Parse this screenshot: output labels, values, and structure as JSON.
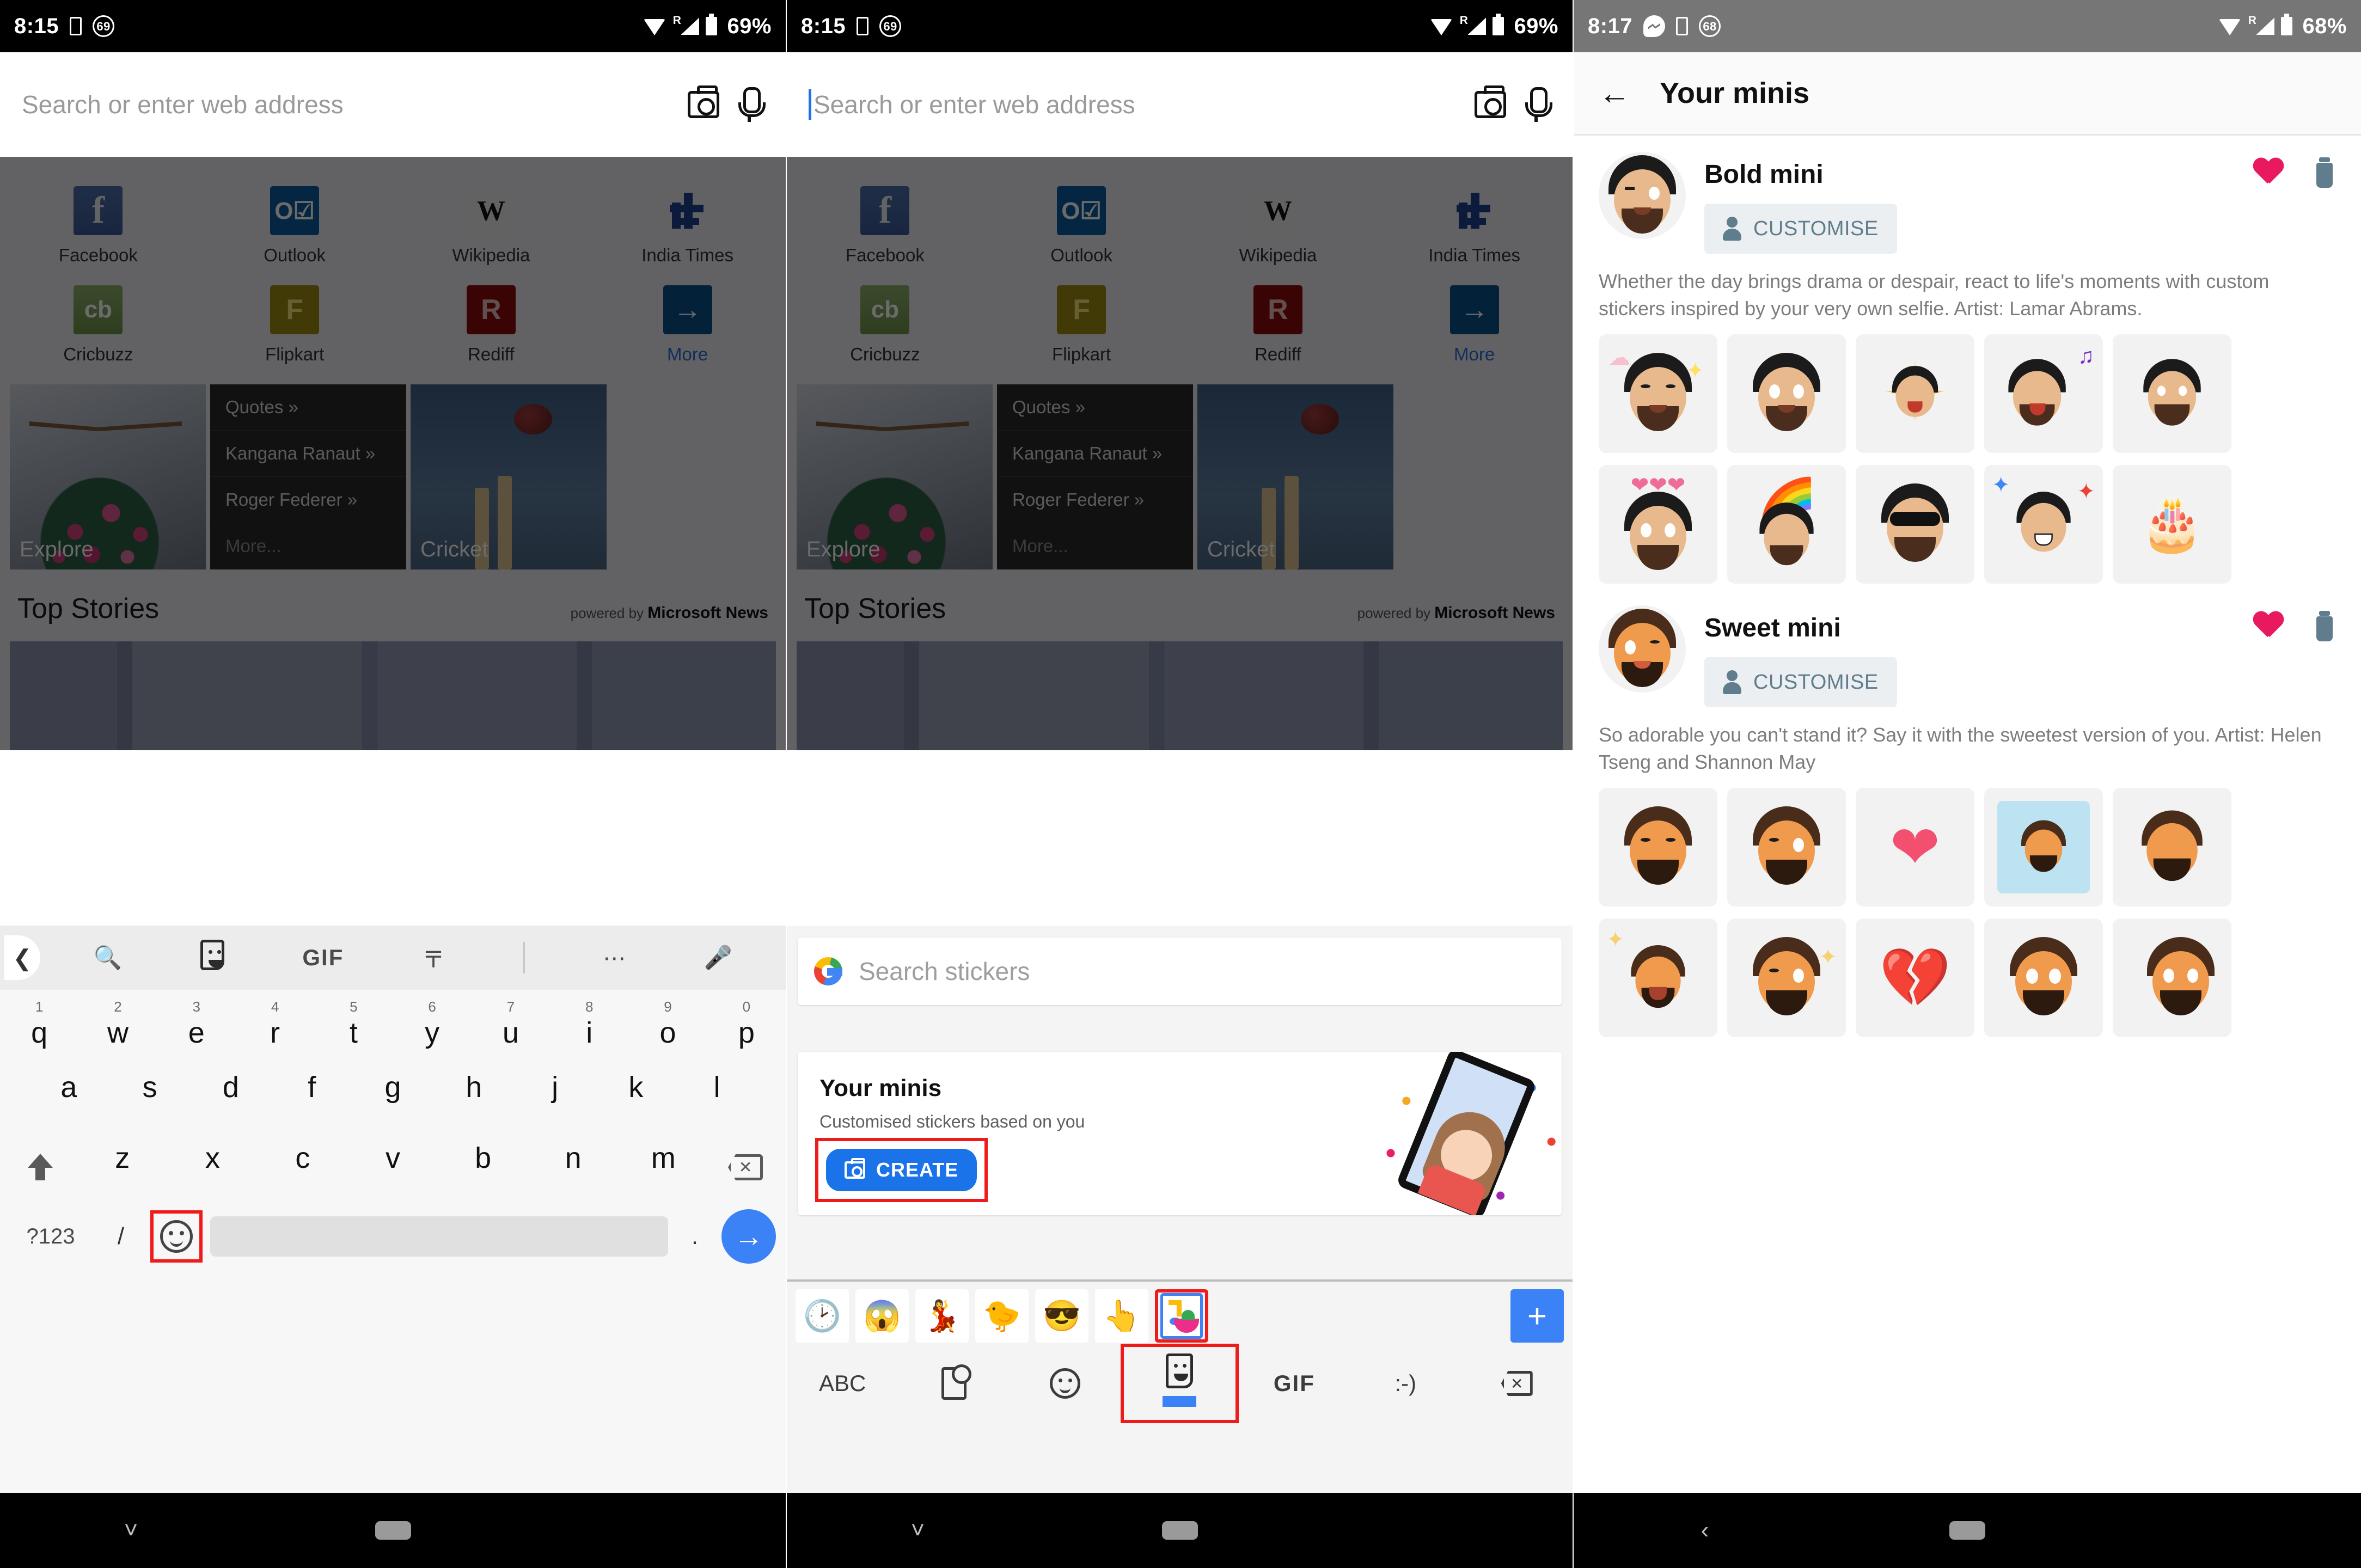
{
  "panel1": {
    "statusbar": {
      "time": "8:15",
      "dnd": "69",
      "battery": "69%",
      "roaming": "R"
    },
    "addressbar": {
      "placeholder": "Search or enter web address",
      "value": "",
      "camera_icon": "camera-icon",
      "mic_icon": "microphone-icon"
    },
    "shortcuts": [
      {
        "label": "Facebook",
        "glyph": "f",
        "type": "fb"
      },
      {
        "label": "Outlook",
        "glyph": "O",
        "type": "ol"
      },
      {
        "label": "Wikipedia",
        "glyph": "W",
        "type": "wk"
      },
      {
        "label": "India Times",
        "glyph": "",
        "type": "it"
      },
      {
        "label": "Cricbuzz",
        "glyph": "cb",
        "type": "cb"
      },
      {
        "label": "Flipkart",
        "glyph": "F",
        "type": "fk"
      },
      {
        "label": "Rediff",
        "glyph": "R",
        "type": "rd"
      },
      {
        "label": "More",
        "glyph": "→",
        "type": "mr"
      }
    ],
    "cards": {
      "explore": "Explore",
      "cricket": "Cricket",
      "quotes": [
        "Quotes »",
        "Kangana Ranaut »",
        "Roger Federer »",
        "More..."
      ]
    },
    "topstories": {
      "title": "Top Stories",
      "powered_prefix": "powered by",
      "powered_brand": "Microsoft News"
    },
    "keyboard": {
      "toolbar": [
        "back-chevron",
        "search-icon",
        "sticker-icon",
        "GIF",
        "translate-icon",
        "more-icon",
        "microphone-icon"
      ],
      "gif_label": "GIF",
      "row1": [
        {
          "num": "1",
          "ltr": "q"
        },
        {
          "num": "2",
          "ltr": "w"
        },
        {
          "num": "3",
          "ltr": "e"
        },
        {
          "num": "4",
          "ltr": "r"
        },
        {
          "num": "5",
          "ltr": "t"
        },
        {
          "num": "6",
          "ltr": "y"
        },
        {
          "num": "7",
          "ltr": "u"
        },
        {
          "num": "8",
          "ltr": "i"
        },
        {
          "num": "9",
          "ltr": "o"
        },
        {
          "num": "0",
          "ltr": "p"
        }
      ],
      "row2": [
        "a",
        "s",
        "d",
        "f",
        "g",
        "h",
        "j",
        "k",
        "l"
      ],
      "row3": [
        "z",
        "x",
        "c",
        "v",
        "b",
        "n",
        "m"
      ],
      "symbols_key": "?123",
      "slash_key": "/",
      "emoji_key": "emoji-smiley-icon",
      "period_key": ".",
      "go_key": "→",
      "highlight_color": "#ef1b1b"
    }
  },
  "panel2": {
    "statusbar": {
      "time": "8:15",
      "dnd": "69",
      "battery": "69%",
      "roaming": "R"
    },
    "addressbar": {
      "placeholder": "Search or enter web address",
      "value": "",
      "caret": true
    },
    "sticker_search": {
      "placeholder": "Search stickers",
      "logo": "google-logo-icon"
    },
    "minis_promo": {
      "title": "Your minis",
      "subtitle": "Customised stickers based on you",
      "create_label": "CREATE",
      "create_icon": "camera-icon",
      "highlighted": true
    },
    "sticker_tabs": [
      "recent-clock-icon",
      "shocked-sticker",
      "dancer-sticker",
      "duck-sticker",
      "sunglasses-sticker",
      "thumbsup-sticker",
      "your-minis-tab"
    ],
    "add_pack_label": "+",
    "keyboard_bottom": [
      "ABC",
      "sticker-search-icon",
      "emoji-icon",
      "sticker-icon",
      "GIF",
      ":-)",
      "backspace-icon"
    ],
    "abc_label": "ABC",
    "gif_label": "GIF",
    "emoticon_label": ":-)"
  },
  "panel3": {
    "statusbar": {
      "time": "8:17",
      "messenger": "messenger-icon",
      "dnd": "68",
      "battery": "68%",
      "roaming": "R"
    },
    "header": {
      "back": "back-arrow-icon",
      "title": "Your minis"
    },
    "minis": [
      {
        "name": "Bold mini",
        "customise_label": "CUSTOMISE",
        "favourite": true,
        "description": "Whether the day brings drama or despair, react to life's moments with custom stickers inspired by your very own selfie. Artist: Lamar Abrams.",
        "stickers_row1": [
          "blush-sparkle",
          "thumbs-up",
          "shouting-rays",
          "singing-microphone",
          "drink-toast"
        ],
        "stickers_row2": [
          "hearts-crown",
          "rainbow-hands",
          "sunglasses-point",
          "confetti-cheer",
          "birthday-cake"
        ]
      },
      {
        "name": "Sweet mini",
        "customise_label": "CUSTOMISE",
        "favourite": true,
        "description": "So adorable you can't stand it? Say it with the sweetest version of you. Artist: Helen Tseng and Shannon May",
        "stickers_row1": [
          "crying-sad",
          "wink-thinking",
          "big-heart-hug",
          "bath-relax",
          "shy-peek"
        ],
        "stickers_row2": [
          "crying-loud",
          "wink-sparkle",
          "broken-heart",
          "surprised-hands",
          "eating-fork"
        ]
      }
    ]
  },
  "colors": {
    "accent_blue": "#3b82f6",
    "highlight_red": "#ef1b1b",
    "heart_pink": "#e8195f",
    "customise_text": "#5f7d8c",
    "link_blue": "#2a6fd6"
  }
}
